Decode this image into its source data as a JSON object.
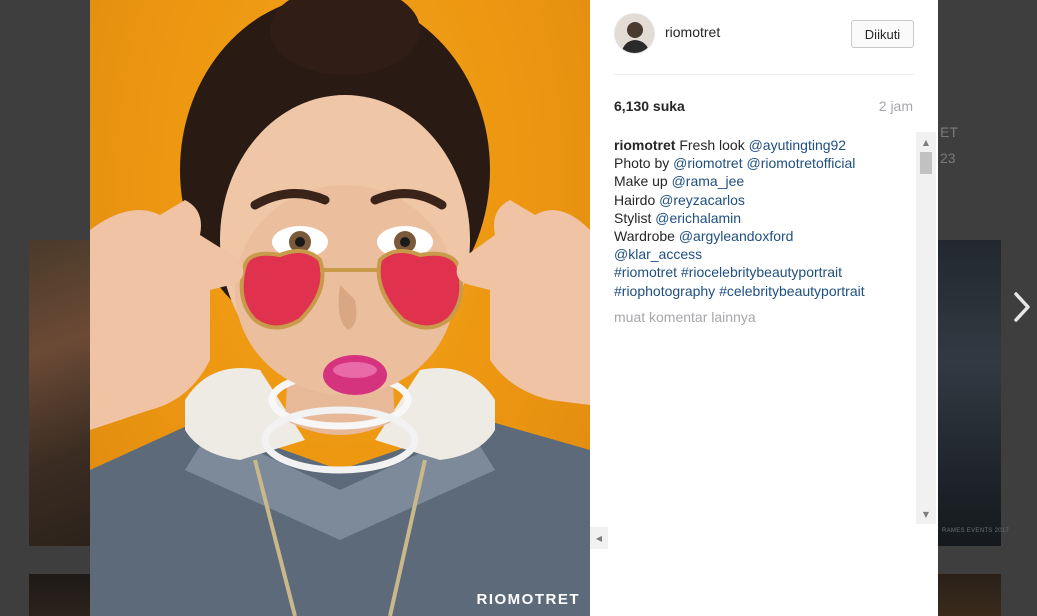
{
  "background": {
    "meta_line1": "ET",
    "meta_line2": "23",
    "watermark": "RAMES EVENTS 2017"
  },
  "photo": {
    "watermark": "RIOMOTRET",
    "alt": "portrait"
  },
  "header": {
    "username": "riomotret",
    "follow_label": "Diikuti"
  },
  "stats": {
    "likes": "6,130 suka",
    "time": "2 jam"
  },
  "caption": {
    "author": "riomotret",
    "lines": [
      {
        "prefix": " Fresh look ",
        "link": "@ayutingting92"
      },
      {
        "prefix": "Photo by ",
        "link": "@riomotret @riomotretofficial"
      },
      {
        "prefix": "Make up ",
        "link": "@rama_jee"
      },
      {
        "prefix": "Hairdo ",
        "link": "@reyzacarlos"
      },
      {
        "prefix": "Stylist ",
        "link": "@erichalamin"
      },
      {
        "prefix": "Wardrobe ",
        "link": "@argyleandoxford"
      },
      {
        "prefix": "",
        "link": "@klar_access"
      },
      {
        "prefix": "",
        "link": "#riomotret #riocelebritybeautyportrait"
      },
      {
        "prefix": "",
        "link": "#riophotography #celebritybeautyportrait"
      }
    ],
    "more_comments": "muat komentar lainnya"
  },
  "icons": {
    "next": "chevron-right-icon",
    "scroll_up": "triangle-up-icon",
    "scroll_down": "triangle-down-icon",
    "scroll_left": "triangle-left-icon"
  },
  "colors": {
    "link": "#1f4f80",
    "muted": "#a5a7aa",
    "photo_bg": "#ee9812"
  }
}
